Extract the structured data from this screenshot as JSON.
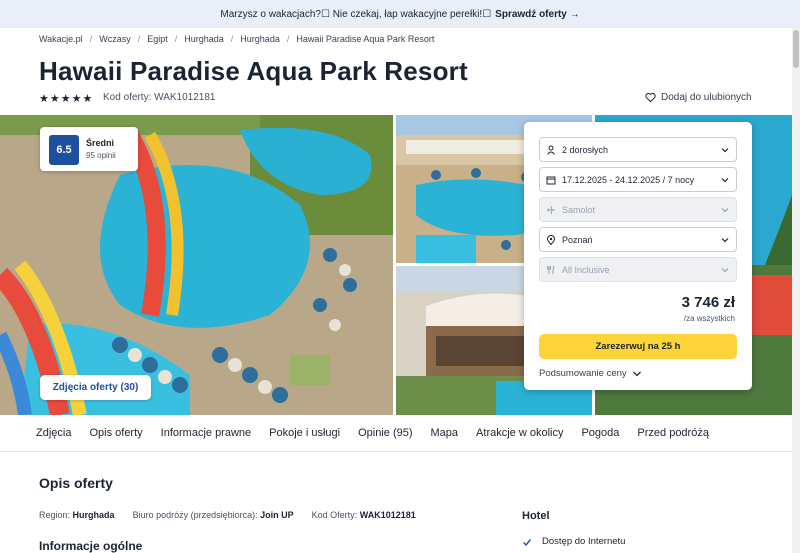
{
  "promo": {
    "text": "Marzysz o wakacjach?☐ Nie czekaj, łap wakacyjne perełki!☐",
    "cta": "Sprawdź oferty →"
  },
  "breadcrumb": [
    "Wakacje.pl",
    "Wczasy",
    "Egipt",
    "Hurghada",
    "Hurghada",
    "Hawaii Paradise Aqua Park Resort"
  ],
  "hotel": {
    "name": "Hawaii Paradise Aqua Park Resort",
    "stars": 5,
    "offer_code_label": "Kod oferty: WAK1012181",
    "favorite_label": "Dodaj do ulubionych"
  },
  "rating": {
    "score": "6.5",
    "label": "Średni",
    "count": "95 opinii"
  },
  "photos_button": "Zdjęcia oferty (30)",
  "booking": {
    "travelers": "2 dorosłych",
    "dates": "17.12.2025 - 24.12.2025 / 7 nocy",
    "transport": "Samolot",
    "departure": "Poznań",
    "board": "All Inclusive",
    "price": "3 746 zł",
    "price_note": "/za wszystkich",
    "book_button": "Zarezerwuj na 25 h",
    "summary_label": "Podsumowanie ceny"
  },
  "tabs": [
    "Zdjęcia",
    "Opis oferty",
    "Informacje prawne",
    "Pokoje i usługi",
    "Opinie (95)",
    "Mapa",
    "Atrakcje w okolicy",
    "Pogoda",
    "Przed podróżą"
  ],
  "description": {
    "heading": "Opis oferty",
    "region_label": "Region:",
    "region_value": "Hurghada",
    "agency_label": "Biuro podróży (przedsiębiorca):",
    "agency_value": "Join UP",
    "code_label": "Kod Oferty:",
    "code_value": "WAK1012181",
    "general_heading": "Informacje ogólne"
  },
  "hotel_section": {
    "heading": "Hotel",
    "amenity": "Dostęp do Internetu"
  },
  "colors": {
    "accent": "#1d4fa0",
    "cta": "#fcd43a",
    "promo_bg": "#e9eef8"
  }
}
